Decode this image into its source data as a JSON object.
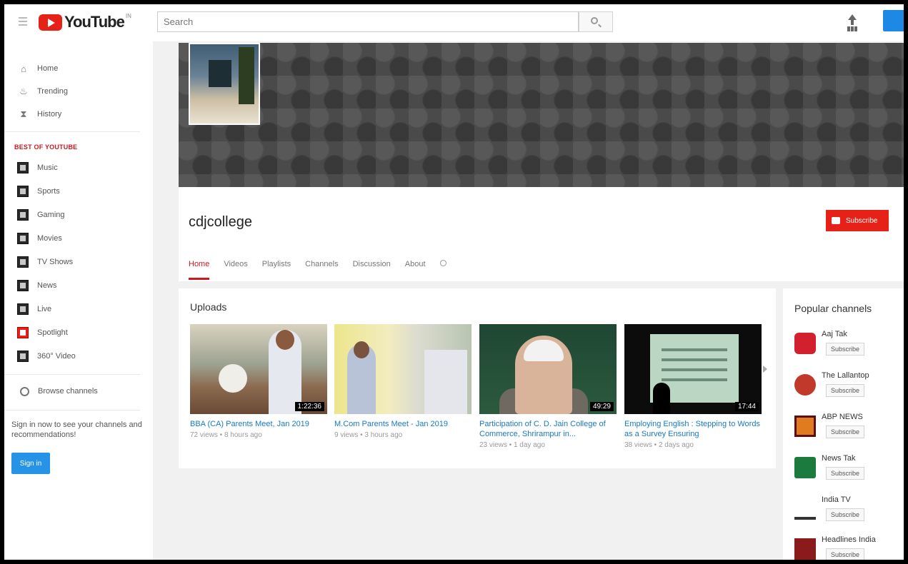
{
  "masthead": {
    "logo_text": "YouTube",
    "logo_tm": "IN",
    "search_placeholder": "Search"
  },
  "guide": {
    "top_items": [
      {
        "label": "Home",
        "icon": "home-icon"
      },
      {
        "label": "Trending",
        "icon": "trending-icon"
      },
      {
        "label": "History",
        "icon": "history-icon"
      }
    ],
    "section_heading": "BEST OF YOUTUBE",
    "categories": [
      {
        "label": "Music",
        "icon": "music-icon"
      },
      {
        "label": "Sports",
        "icon": "sports-icon"
      },
      {
        "label": "Gaming",
        "icon": "gaming-icon"
      },
      {
        "label": "Movies",
        "icon": "movies-icon"
      },
      {
        "label": "TV Shows",
        "icon": "tv-shows-icon"
      },
      {
        "label": "News",
        "icon": "news-icon"
      },
      {
        "label": "Live",
        "icon": "live-icon"
      },
      {
        "label": "Spotlight",
        "icon": "spotlight-icon"
      },
      {
        "label": "360° Video",
        "icon": "360-video-icon"
      }
    ],
    "browse_channels": "Browse channels",
    "signin_prompt": "Sign in now to see your channels and recommendations!",
    "signin_button": "Sign in"
  },
  "channel": {
    "name": "cdjcollege",
    "subscribe_label": "Subscribe",
    "tabs": [
      "Home",
      "Videos",
      "Playlists",
      "Channels",
      "Discussion",
      "About"
    ],
    "active_tab": "Home"
  },
  "uploads": {
    "title": "Uploads",
    "videos": [
      {
        "title": "BBA (CA) Parents Meet, Jan 2019",
        "meta": "72 views • 8 hours ago",
        "duration": "1:22:36"
      },
      {
        "title": "M.Com Parents Meet - Jan 2019",
        "meta": "9 views • 3 hours ago",
        "duration": ""
      },
      {
        "title": "Participation of C. D. Jain College of Commerce, Shrirampur in...",
        "meta": "23 views • 1 day ago",
        "duration": "49:29"
      },
      {
        "title": "Employing English : Stepping to Words as a Survey Ensuring",
        "meta": "38 views • 2 days ago",
        "duration": "17:44"
      }
    ]
  },
  "popular": {
    "title": "Popular channels",
    "channels": [
      {
        "name": "Aaj Tak",
        "subscribe": "Subscribe",
        "color": "#d3202f"
      },
      {
        "name": "The Lallantop",
        "subscribe": "Subscribe",
        "color": "#c0392b"
      },
      {
        "name": "ABP NEWS",
        "subscribe": "Subscribe",
        "color": "#e07b1f"
      },
      {
        "name": "News Tak",
        "subscribe": "Subscribe",
        "color": "#1b7a3e"
      },
      {
        "name": "India TV",
        "subscribe": "Subscribe",
        "color": "#333333"
      },
      {
        "name": "Headlines India",
        "subscribe": "Subscribe",
        "color": "#8b1a1a"
      }
    ]
  }
}
